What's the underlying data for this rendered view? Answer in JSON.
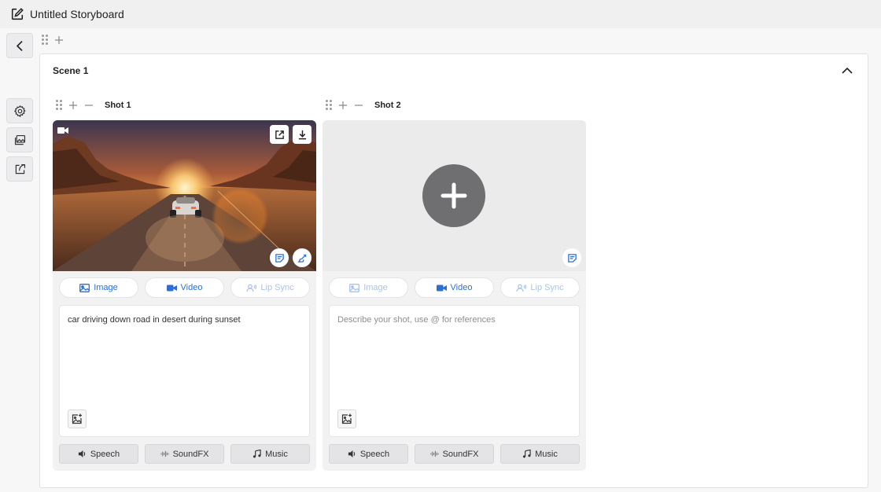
{
  "app": {
    "title": "Untitled Storyboard"
  },
  "sidebar": {
    "back": "back-icon",
    "items": [
      {
        "name": "settings",
        "icon": "gear-icon"
      },
      {
        "name": "gallery",
        "icon": "image-stack-icon"
      },
      {
        "name": "share",
        "icon": "share-icon"
      }
    ]
  },
  "scene": {
    "title": "Scene 1",
    "collapsed": false
  },
  "shots": [
    {
      "label": "Shot 1",
      "has_media": true,
      "tabs": {
        "image": "Image",
        "video": "Video",
        "lipsync": "Lip Sync"
      },
      "prompt_value": "car driving down road in desert during sunset",
      "audio": {
        "speech": "Speech",
        "soundfx": "SoundFX",
        "music": "Music"
      }
    },
    {
      "label": "Shot 2",
      "has_media": false,
      "tabs": {
        "image": "Image",
        "video": "Video",
        "lipsync": "Lip Sync"
      },
      "prompt_placeholder": "Describe your shot, use @ for references",
      "audio": {
        "speech": "Speech",
        "soundfx": "SoundFX",
        "music": "Music"
      }
    }
  ],
  "colors": {
    "accent": "#2b6fd6",
    "accent_dim": "#a9c3ea",
    "canvas": "#f7f7f8"
  }
}
